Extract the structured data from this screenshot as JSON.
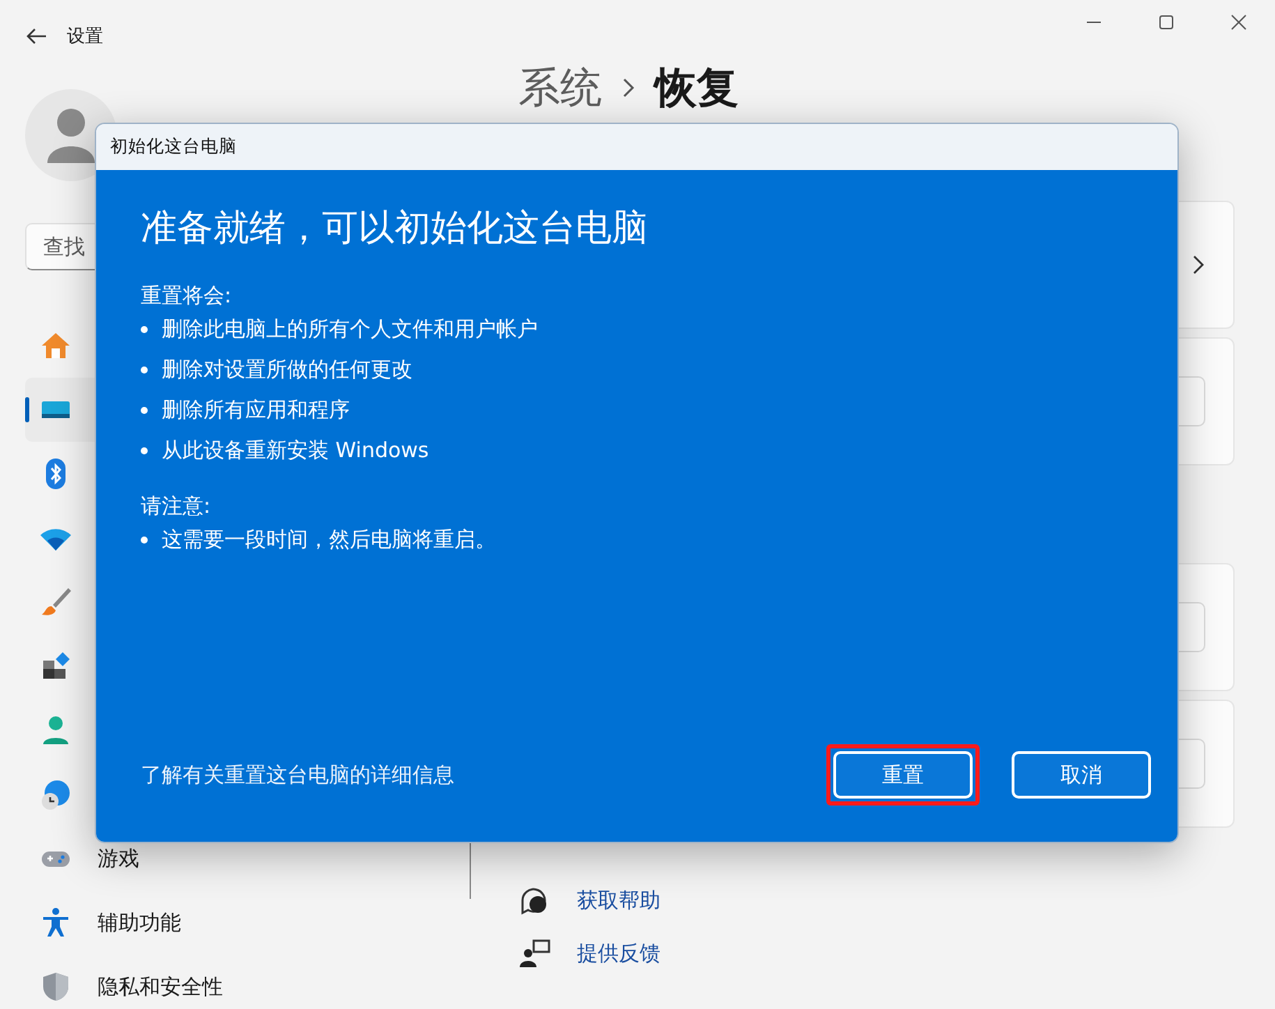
{
  "window": {
    "title": "设置"
  },
  "search": {
    "placeholder": "查找"
  },
  "sidebar": {
    "items": [
      {
        "selected": false
      },
      {
        "selected": true
      },
      {
        "selected": false
      },
      {
        "selected": false
      },
      {
        "selected": false
      },
      {
        "selected": false
      },
      {
        "selected": false
      },
      {
        "selected": false
      },
      {
        "label": "游戏",
        "selected": false
      },
      {
        "label": "辅助功能",
        "selected": false
      },
      {
        "label": "隐私和安全性",
        "selected": false
      }
    ]
  },
  "breadcrumb": [
    "系统",
    "恢复"
  ],
  "help_links": [
    {
      "label": "获取帮助"
    },
    {
      "label": "提供反馈"
    }
  ],
  "dialog": {
    "title": "初始化这台电脑",
    "heading": "准备就绪，可以初始化这台电脑",
    "sections": [
      {
        "label": "重置将会:",
        "bullets": [
          "删除此电脑上的所有个人文件和用户帐户",
          "删除对设置所做的任何更改",
          "删除所有应用和程序",
          "从此设备重新安装 Windows"
        ]
      },
      {
        "label": "请注意:",
        "bullets": [
          "这需要一段时间，然后电脑将重启。"
        ]
      }
    ],
    "link": "了解有关重置这台电脑的详细信息",
    "buttons": [
      {
        "label": "重置",
        "highlighted": true
      },
      {
        "label": "取消",
        "highlighted": false
      }
    ]
  }
}
